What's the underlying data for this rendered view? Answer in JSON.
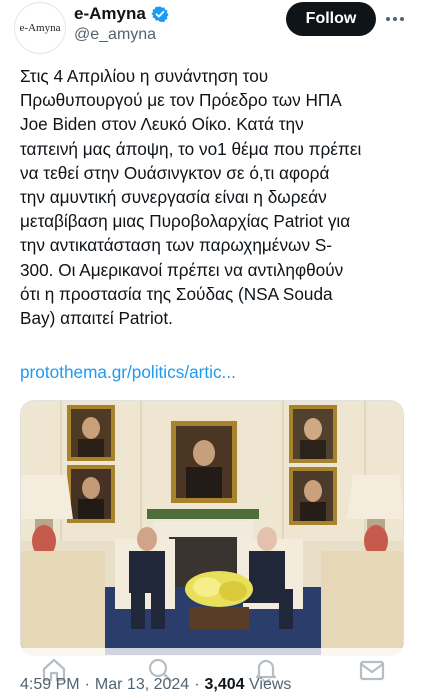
{
  "account": {
    "avatar_text": "e-Amyna",
    "display_name": "e-Amyna",
    "handle": "@e_amyna",
    "verified": true
  },
  "actions": {
    "follow_label": "Follow"
  },
  "tweet": {
    "text": "Στις 4 Απριλίου η συνάντηση του\nΠρωθυπουργού με τον Πρόεδρο των ΗΠΑ\nJoe Biden στον Λευκό Οίκο. Κατά την\nταπεινή μας άποψη, το νο1 θέμα που πρέπει\nνα τεθεί στην Ουάσινγκτον σε ό,τι αφορά\nτην αμυντική συνεργασία είναι η δωρεάν\nμεταβίβαση μιας Πυροβολαρχίας Patriot για\nτην αντικατάσταση των παρωχημένων S-\n300. Οι Αμερικανοί πρέπει να αντιληφθούν\nότι η προστασία της Σούδας (NSA Souda\nBay) απαιτεί Patriot.",
    "link_text": "protothema.gr/politics/artic..."
  },
  "meta": {
    "time": "4:59 PM",
    "separator": "·",
    "date": "Mar 13, 2024",
    "views_count": "3,404",
    "views_label": "Views"
  },
  "colors": {
    "link": "#1d9bf0",
    "verified_badge": "#1d9bf0",
    "follow_bg": "#0f1419",
    "secondary_text": "#536471"
  },
  "icons": {
    "more": "more-horizontal-icon",
    "verified": "verified-badge-icon",
    "tabs": [
      "home-icon",
      "search-icon",
      "notifications-icon",
      "messages-icon"
    ]
  }
}
